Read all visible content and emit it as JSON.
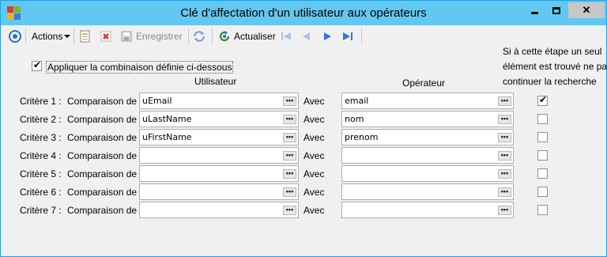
{
  "window": {
    "title": "Clé d'affectation d'un utilisateur aux opérateurs",
    "minimize_icon": "minimize-icon",
    "maximize_icon": "maximize-icon",
    "close_label": "✕"
  },
  "toolbar": {
    "actions_label": "Actions",
    "save_label": "Enregistrer",
    "refresh_label": "Actualiser"
  },
  "form": {
    "apply_combination_label": "Appliquer la combinaison définie ci-dessous",
    "apply_combination_checked": true,
    "col_user": "Utilisateur",
    "col_operator": "Opérateur",
    "stop_note": [
      "Si à cette étape un seul",
      "élément est trouvé ne pas",
      "continuer la recherche"
    ],
    "compare_label": "Comparaison de :",
    "with_label": "Avec",
    "criteria": [
      {
        "label": "Critère 1 :",
        "user": "uEmail",
        "operator": "email",
        "stop": true
      },
      {
        "label": "Critère 2 :",
        "user": "uLastName",
        "operator": "nom",
        "stop": false
      },
      {
        "label": "Critère 3 :",
        "user": "uFirstName",
        "operator": "prenom",
        "stop": false
      },
      {
        "label": "Critère 4 :",
        "user": "",
        "operator": "",
        "stop": false
      },
      {
        "label": "Critère 5 :",
        "user": "",
        "operator": "",
        "stop": false
      },
      {
        "label": "Critère 6 :",
        "user": "",
        "operator": "",
        "stop": false
      },
      {
        "label": "Critère 7 :",
        "user": "",
        "operator": "",
        "stop": false
      }
    ]
  },
  "colors": {
    "titlebar": "#62c8f1",
    "window_border": "#1fa1e3",
    "nav_blue": "#2e78d6"
  }
}
